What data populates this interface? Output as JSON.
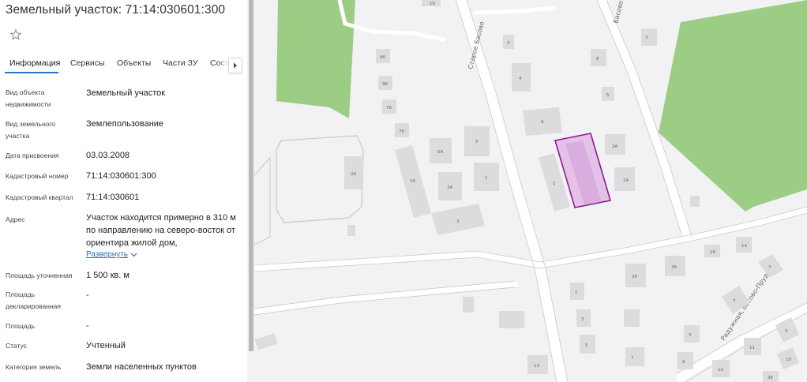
{
  "panel": {
    "title": "Земельный участок: 71:14:030601:300",
    "tabs": [
      "Информация",
      "Сервисы",
      "Объекты",
      "Части ЗУ",
      "Соста"
    ],
    "active_tab": "Информация",
    "rows": [
      {
        "label": "Вид объекта недвижимости",
        "value": "Земельный участок"
      },
      {
        "label": "Вид земельного участка",
        "value": "Землепользование"
      },
      {
        "label": "Дата присвоения",
        "value": "03.03.2008"
      },
      {
        "label": "Кадастровый номер",
        "value": "71:14:030601:300"
      },
      {
        "label": "Кадастровый квартал",
        "value": "71:14:030601"
      },
      {
        "label": "Адрес",
        "value": "Участок находится примерно в 310 м по направлению на северо-восток от ориентира жилой дом,"
      },
      {
        "label": "Площадь уточненная",
        "value": "1 500 кв. м"
      },
      {
        "label": "Площадь декларированная",
        "value": "-"
      },
      {
        "label": "Площадь",
        "value": "-"
      },
      {
        "label": "Статус",
        "value": "Учтенный"
      },
      {
        "label": "Категория земель",
        "value": "Земли населенных пунктов"
      }
    ],
    "expand_label": "Развернуть"
  },
  "map": {
    "streets": [
      "Старое Басово",
      "Басово",
      "Радужная, Басово-Прудный"
    ],
    "buildings": [
      "9б",
      "9б",
      "7б",
      "7б",
      "5А",
      "5",
      "1б",
      "3А",
      "1",
      "3",
      "2",
      "2А",
      "2А",
      "1А",
      "3",
      "4",
      "6",
      "8",
      "5",
      "3",
      "1б",
      "3б",
      "3б",
      "16",
      "14",
      "1",
      "3",
      "5",
      "7",
      "3",
      "3",
      "9",
      "11",
      "12",
      "7",
      "9",
      "13",
      "10",
      "3б"
    ],
    "colors": {
      "parcel_fill": "#e2b9e6",
      "parcel_stroke": "#8b1a8c",
      "green": "#9ccd85",
      "road": "#ffffff",
      "building": "#dcdcdf"
    }
  }
}
